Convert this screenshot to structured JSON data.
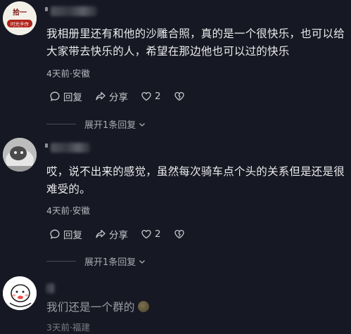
{
  "comments": [
    {
      "avatar_text_top": "拾一",
      "avatar_text_bottom": "时光手作",
      "text": "我相册里还有和他的沙雕合照，真的是一个很快乐，也可以给大家带去快乐的人，希望在那边他也可以过的快乐",
      "meta": "4天前·安徽",
      "reply_label": "回复",
      "share_label": "分享",
      "like_count": "2",
      "expand_label": "展开1条回复"
    },
    {
      "text": "哎，说不出来的感觉，虽然每次骑车点个头的关系但是还是很难受的。",
      "meta": "4天前·安徽",
      "reply_label": "回复",
      "share_label": "分享",
      "like_count": "2",
      "expand_label": "展开1条回复"
    },
    {
      "text": "我们还是一个群的",
      "meta": "3天前·福建"
    }
  ],
  "colors": {
    "background": "#161823",
    "text": "#ececee",
    "secondary": "#b8b9bf"
  }
}
